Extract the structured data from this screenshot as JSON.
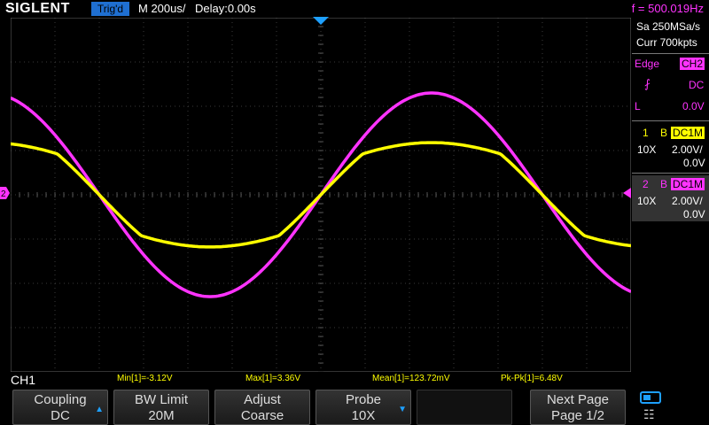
{
  "header": {
    "logo": "SIGLENT",
    "trigger_status": "Trig'd",
    "timebase": "M 200us/",
    "delay": "Delay:0.00s",
    "frequency": "f = 500.019Hz"
  },
  "right_panel": {
    "sample_rate": "Sa 250MSa/s",
    "memory_depth": "Curr 700kpts",
    "trigger": {
      "type": "Edge",
      "source": "CH2",
      "coupling": "DC",
      "slope_icon": "rising-edge-icon",
      "level_mode": "L",
      "level": "0.0V"
    },
    "channel1": {
      "number": "1",
      "bw_flag": "B",
      "coupling": "DC1M",
      "probe": "10X",
      "scale": "2.00V/",
      "offset": "0.0V"
    },
    "channel2": {
      "number": "2",
      "bw_flag": "B",
      "coupling": "DC1M",
      "probe": "10X",
      "scale": "2.00V/",
      "offset": "0.0V"
    }
  },
  "measurements": {
    "active_channel": "CH1",
    "min": "Min[1]=-3.12V",
    "max": "Max[1]=3.36V",
    "mean": "Mean[1]=123.72mV",
    "pkpk": "Pk-Pk[1]=6.48V"
  },
  "softkeys": [
    {
      "line1": "Coupling",
      "line2": "DC",
      "arrow": "up"
    },
    {
      "line1": "BW Limit",
      "line2": "20M",
      "arrow": ""
    },
    {
      "line1": "Adjust",
      "line2": "Coarse",
      "arrow": ""
    },
    {
      "line1": "Probe",
      "line2": "10X",
      "arrow": "down"
    },
    {
      "line1": "",
      "line2": "",
      "arrow": ""
    },
    {
      "line1": "Next Page",
      "line2": "Page 1/2",
      "arrow": ""
    }
  ],
  "colors": {
    "ch1": "#ffff00",
    "ch2": "#ff33ff",
    "accent": "#1ea0ff",
    "grid": "#3a3a3a"
  },
  "waveform_data": {
    "time_divisions": 14,
    "voltage_divisions": 8,
    "ch1_amplitude_v": 3.3,
    "ch2_amplitude_v": 4.6
  }
}
